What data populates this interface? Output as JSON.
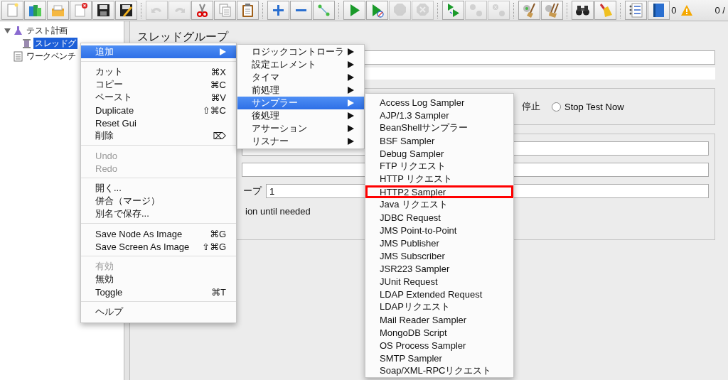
{
  "toolbar": {
    "groups": [
      [
        {
          "kind": "new",
          "disabled": false
        },
        {
          "kind": "templates",
          "disabled": false
        },
        {
          "kind": "open",
          "disabled": false
        },
        {
          "kind": "close",
          "disabled": false
        },
        {
          "kind": "save",
          "disabled": false
        },
        {
          "kind": "save-as",
          "disabled": false
        }
      ],
      [
        {
          "kind": "undo",
          "disabled": true
        },
        {
          "kind": "redo",
          "disabled": true
        },
        {
          "kind": "cut",
          "disabled": false
        },
        {
          "kind": "copy",
          "disabled": false
        },
        {
          "kind": "paste",
          "disabled": false
        }
      ],
      [
        {
          "kind": "expand",
          "disabled": false
        },
        {
          "kind": "collapse",
          "disabled": false
        },
        {
          "kind": "toggle",
          "disabled": false
        }
      ],
      [
        {
          "kind": "start",
          "disabled": false
        },
        {
          "kind": "start-no-pause",
          "disabled": false
        },
        {
          "kind": "stop",
          "disabled": true
        },
        {
          "kind": "shutdown",
          "disabled": true
        }
      ],
      [
        {
          "kind": "remote-start",
          "disabled": false
        },
        {
          "kind": "remote-stop",
          "disabled": true
        },
        {
          "kind": "remote-shutdown",
          "disabled": true
        }
      ],
      [
        {
          "kind": "clear",
          "disabled": false
        },
        {
          "kind": "clear-all",
          "disabled": false
        }
      ],
      [
        {
          "kind": "search",
          "disabled": false
        },
        {
          "kind": "reset-search",
          "disabled": false
        }
      ],
      [
        {
          "kind": "function-helper",
          "disabled": false
        },
        {
          "kind": "help",
          "disabled": false
        }
      ]
    ],
    "warning_count": "0",
    "thread_count": "0 /"
  },
  "tree": [
    {
      "label": "テスト計画",
      "kind": "plan",
      "expanded": true,
      "selected": false,
      "children": [
        {
          "label": "スレッドグ",
          "kind": "thread-group",
          "selected": true
        }
      ]
    },
    {
      "label": "ワークベンチ",
      "kind": "workbench",
      "selected": false
    }
  ],
  "panel": {
    "title": "スレッドグループ",
    "action_fragment": "停止",
    "stop_test_now": {
      "label": "Stop Test Now",
      "selected": false
    },
    "loop_label_fragment": "ープ",
    "loop_value": "1",
    "delay_fragment": "ion until needed"
  },
  "context_menu": {
    "groups": [
      [
        {
          "label": "追加",
          "submenu": true,
          "selected": true,
          "disabled": false
        }
      ],
      [
        {
          "label": "カット",
          "shortcut": "⌘X",
          "submenu": false,
          "selected": false,
          "disabled": false
        },
        {
          "label": "コピー",
          "shortcut": "⌘C",
          "submenu": false,
          "selected": false,
          "disabled": false
        },
        {
          "label": "ペースト",
          "shortcut": "⌘V",
          "submenu": false,
          "selected": false,
          "disabled": false
        },
        {
          "label": "Duplicate",
          "shortcut": "⇧⌘C",
          "submenu": false,
          "selected": false,
          "disabled": false
        },
        {
          "label": "Reset Gui",
          "submenu": false,
          "selected": false,
          "disabled": false
        },
        {
          "label": "削除",
          "shortcut": "⌦",
          "submenu": false,
          "selected": false,
          "disabled": false
        }
      ],
      [
        {
          "label": "Undo",
          "submenu": false,
          "selected": false,
          "disabled": true
        },
        {
          "label": "Redo",
          "submenu": false,
          "selected": false,
          "disabled": true
        }
      ],
      [
        {
          "label": "開く...",
          "submenu": false,
          "selected": false,
          "disabled": false
        },
        {
          "label": "併合（マージ）",
          "submenu": false,
          "selected": false,
          "disabled": false
        },
        {
          "label": "別名で保存...",
          "submenu": false,
          "selected": false,
          "disabled": false
        }
      ],
      [
        {
          "label": "Save Node As Image",
          "shortcut": "⌘G",
          "submenu": false,
          "selected": false,
          "disabled": false
        },
        {
          "label": "Save Screen As Image",
          "shortcut": "⇧⌘G",
          "submenu": false,
          "selected": false,
          "disabled": false
        }
      ],
      [
        {
          "label": "有効",
          "submenu": false,
          "selected": false,
          "disabled": true
        },
        {
          "label": "無効",
          "submenu": false,
          "selected": false,
          "disabled": false
        },
        {
          "label": "Toggle",
          "shortcut": "⌘T",
          "submenu": false,
          "selected": false,
          "disabled": false
        }
      ],
      [
        {
          "label": "ヘルプ",
          "submenu": false,
          "selected": false,
          "disabled": false
        }
      ]
    ]
  },
  "add_submenu": [
    {
      "label": "ロジックコントローラ",
      "selected": false
    },
    {
      "label": "設定エレメント",
      "selected": false
    },
    {
      "label": "タイマ",
      "selected": false
    },
    {
      "label": "前処理",
      "selected": false
    },
    {
      "label": "サンプラー",
      "selected": true
    },
    {
      "label": "後処理",
      "selected": false
    },
    {
      "label": "アサーション",
      "selected": false
    },
    {
      "label": "リスナー",
      "selected": false
    }
  ],
  "sampler_submenu": [
    {
      "label": "Access Log Sampler",
      "outlined": false
    },
    {
      "label": "AJP/1.3 Sampler",
      "outlined": false
    },
    {
      "label": "BeanShellサンプラー",
      "outlined": false
    },
    {
      "label": "BSF Sampler",
      "outlined": false
    },
    {
      "label": "Debug Sampler",
      "outlined": false
    },
    {
      "label": "FTP リクエスト",
      "outlined": false
    },
    {
      "label": "HTTP リクエスト",
      "outlined": false
    },
    {
      "label": "HTTP2 Sampler",
      "outlined": true
    },
    {
      "label": "Java リクエスト",
      "outlined": false
    },
    {
      "label": "JDBC Request",
      "outlined": false
    },
    {
      "label": "JMS Point-to-Point",
      "outlined": false
    },
    {
      "label": "JMS Publisher",
      "outlined": false
    },
    {
      "label": "JMS Subscriber",
      "outlined": false
    },
    {
      "label": "JSR223 Sampler",
      "outlined": false
    },
    {
      "label": "JUnit Request",
      "outlined": false
    },
    {
      "label": "LDAP Extended Request",
      "outlined": false
    },
    {
      "label": "LDAPリクエスト",
      "outlined": false
    },
    {
      "label": "Mail Reader Sampler",
      "outlined": false
    },
    {
      "label": "MongoDB Script",
      "outlined": false
    },
    {
      "label": "OS Process Sampler",
      "outlined": false
    },
    {
      "label": "SMTP Sampler",
      "outlined": false
    },
    {
      "label": "Soap/XML-RPCリクエスト",
      "outlined": false
    }
  ]
}
